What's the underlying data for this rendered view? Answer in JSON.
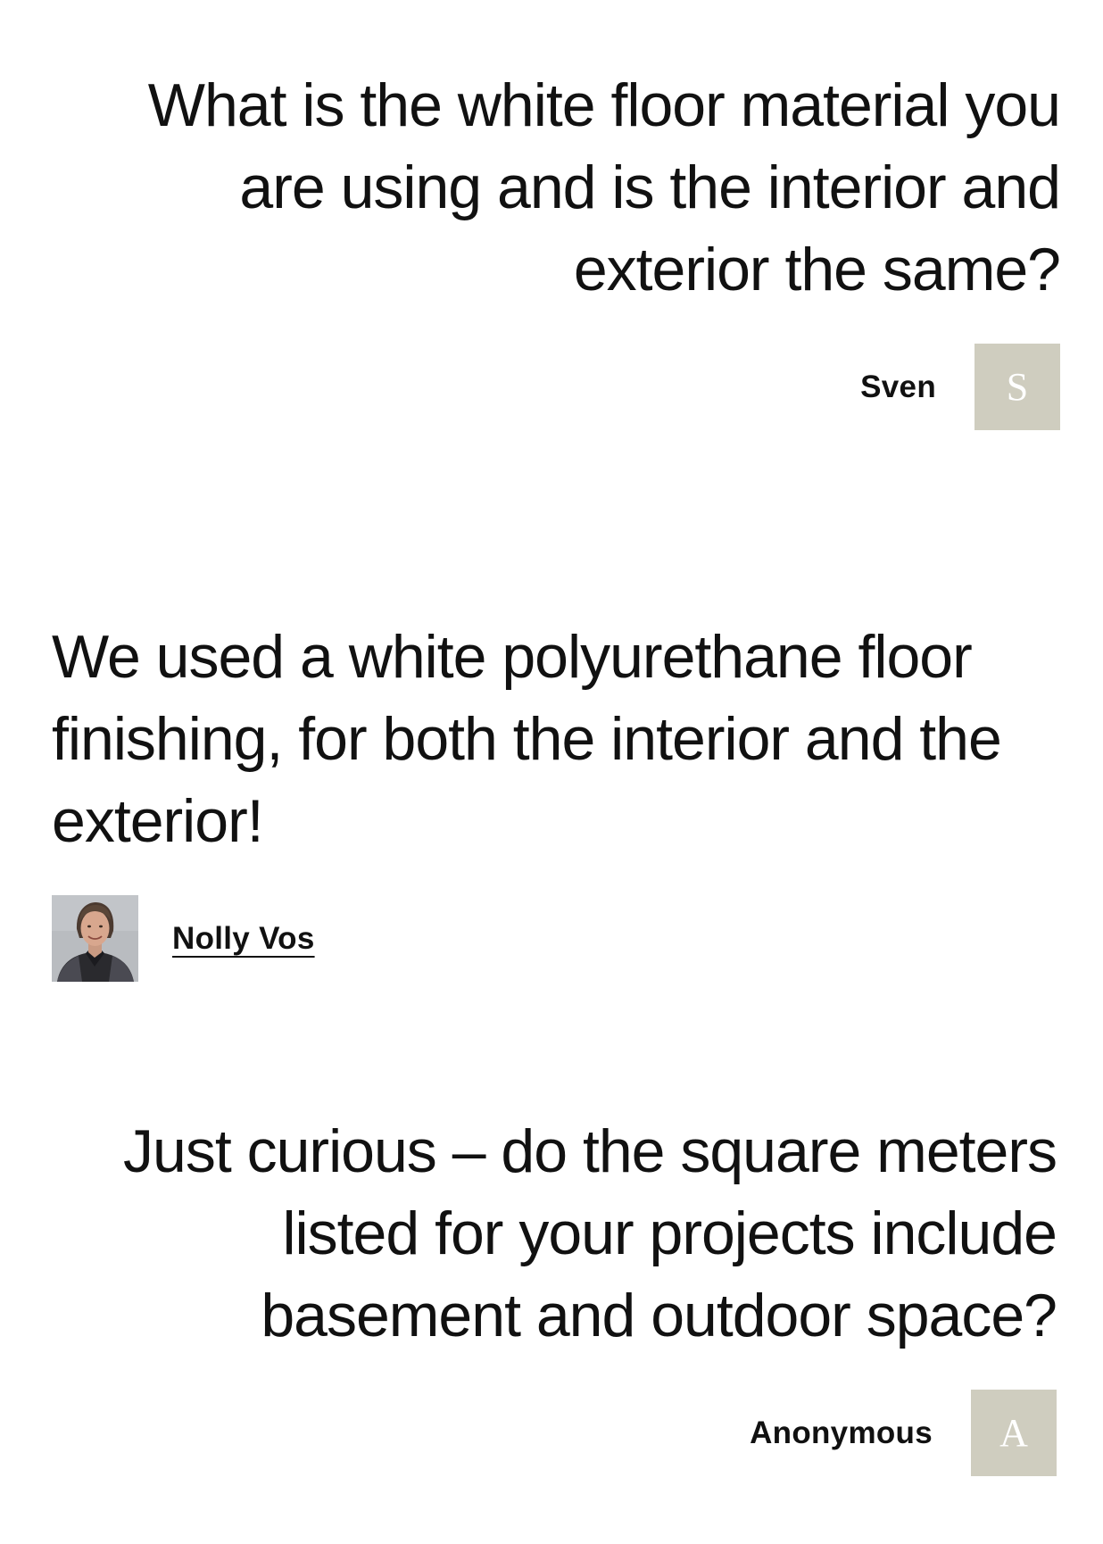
{
  "comments": [
    {
      "text": "What is the white floor material you are using and is the interior and exterior the same?",
      "author": "Sven",
      "avatar_initial": "S",
      "align": "right"
    },
    {
      "text": "We used a white polyurethane floor finishing, for both the interior and the exterior!",
      "author": "Nolly Vos",
      "avatar_icon": "person-photo-icon",
      "align": "left"
    },
    {
      "text": "Just curious – do the square meters listed for your projects include basement and outdoor space?",
      "author": "Anonymous",
      "avatar_initial": "A",
      "align": "right"
    }
  ],
  "colors": {
    "text": "#111111",
    "avatar_bg": "#cfcdbf",
    "background": "#ffffff"
  }
}
